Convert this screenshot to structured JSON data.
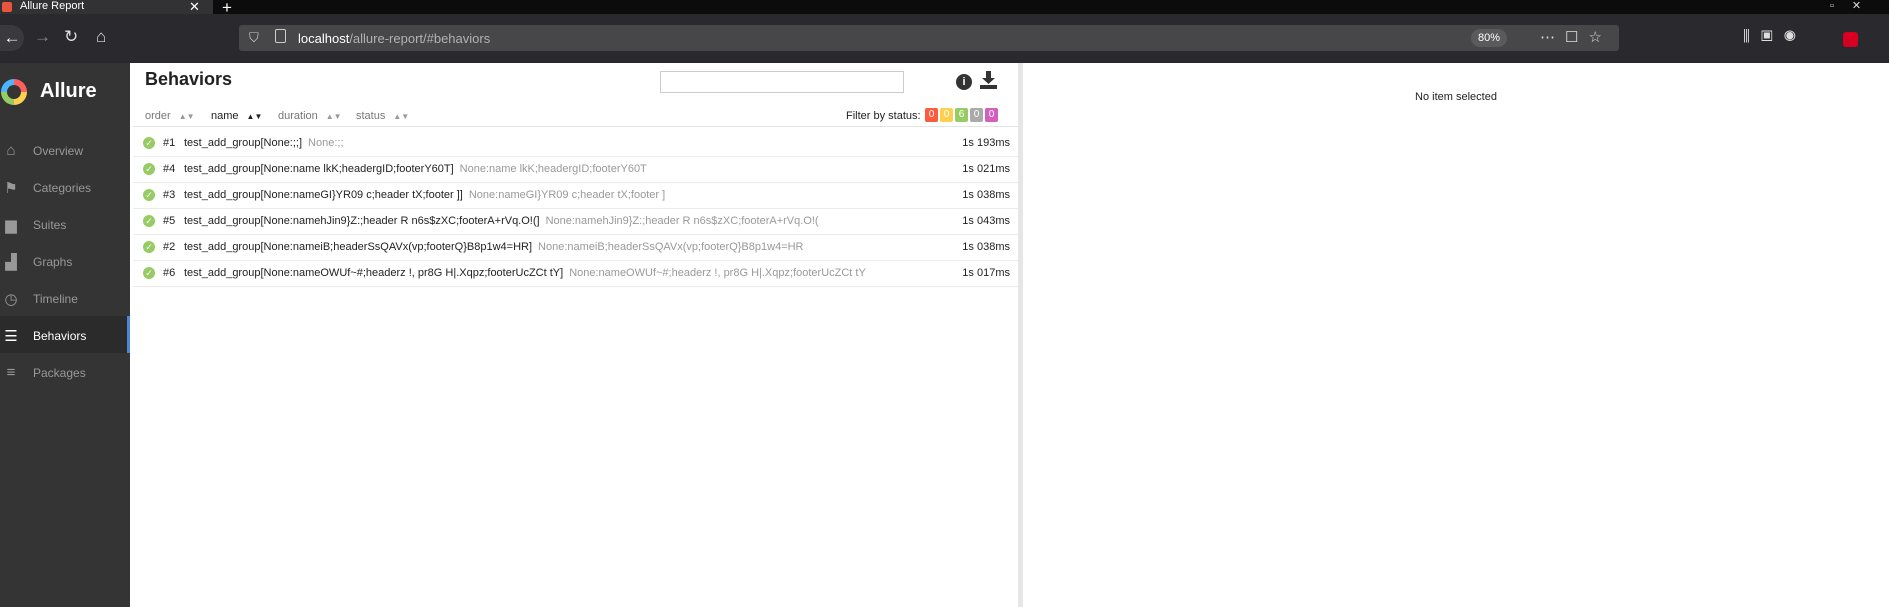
{
  "browser": {
    "tab_title": "Allure Report",
    "tab_close": "✕",
    "new_tab": "+",
    "url_host": "localhost",
    "url_path": "/allure-report/#behaviors",
    "zoom": "80%"
  },
  "sidebar": {
    "brand": "Allure",
    "items": [
      {
        "label": "Overview",
        "icon": "home-icon"
      },
      {
        "label": "Categories",
        "icon": "flag-icon"
      },
      {
        "label": "Suites",
        "icon": "briefcase-icon"
      },
      {
        "label": "Graphs",
        "icon": "bar-chart-icon"
      },
      {
        "label": "Timeline",
        "icon": "clock-icon"
      },
      {
        "label": "Behaviors",
        "icon": "list-icon",
        "active": true
      },
      {
        "label": "Packages",
        "icon": "align-left-icon"
      }
    ]
  },
  "main": {
    "title": "Behaviors",
    "search_placeholder": "",
    "sort_columns": [
      "order",
      "name",
      "duration",
      "status"
    ],
    "active_sort": "name",
    "filter_label": "Filter by status:",
    "status_counts": [
      {
        "value": "0",
        "color": "#fd5a3e",
        "status": "failed"
      },
      {
        "value": "0",
        "color": "#ffd050",
        "status": "broken"
      },
      {
        "value": "6",
        "color": "#97cc64",
        "status": "passed"
      },
      {
        "value": "0",
        "color": "#aaaaaa",
        "status": "skipped"
      },
      {
        "value": "0",
        "color": "#d35ebe",
        "status": "unknown"
      }
    ],
    "rows": [
      {
        "num": "#1",
        "name": "test_add_group[None:;;]",
        "params": "None:;;",
        "duration": "1s 193ms"
      },
      {
        "num": "#4",
        "name": "test_add_group[None:name lkK;headergID;footerY60T]",
        "params": "None:name lkK;headergID;footerY60T",
        "duration": "1s 021ms"
      },
      {
        "num": "#3",
        "name": "test_add_group[None:nameGI}YR09 c;header tX;footer ]]",
        "params": "None:nameGI}YR09 c;header tX;footer ]",
        "duration": "1s 038ms"
      },
      {
        "num": "#5",
        "name": "test_add_group[None:namehJin9}Z:;header R n6s$zXC;footerA+rVq.O!(]",
        "params": "None:namehJin9}Z:;header R n6s$zXC;footerA+rVq.O!(",
        "duration": "1s 043ms"
      },
      {
        "num": "#2",
        "name": "test_add_group[None:nameiB;headerSsQAVx(vp;footerQ}B8p1w4=HR]",
        "params": "None:nameiB;headerSsQAVx(vp;footerQ}B8p1w4=HR",
        "duration": "1s 038ms"
      },
      {
        "num": "#6",
        "name": "test_add_group[None:nameOWUf~#;headerz !, pr8G H|.Xqpz;footerUcZCt tY]",
        "params": "None:nameOWUf~#;headerz !, pr8G H|.Xqpz;footerUcZCt tY",
        "duration": "1s 017ms"
      }
    ]
  },
  "detail": {
    "empty_text": "No item selected"
  }
}
